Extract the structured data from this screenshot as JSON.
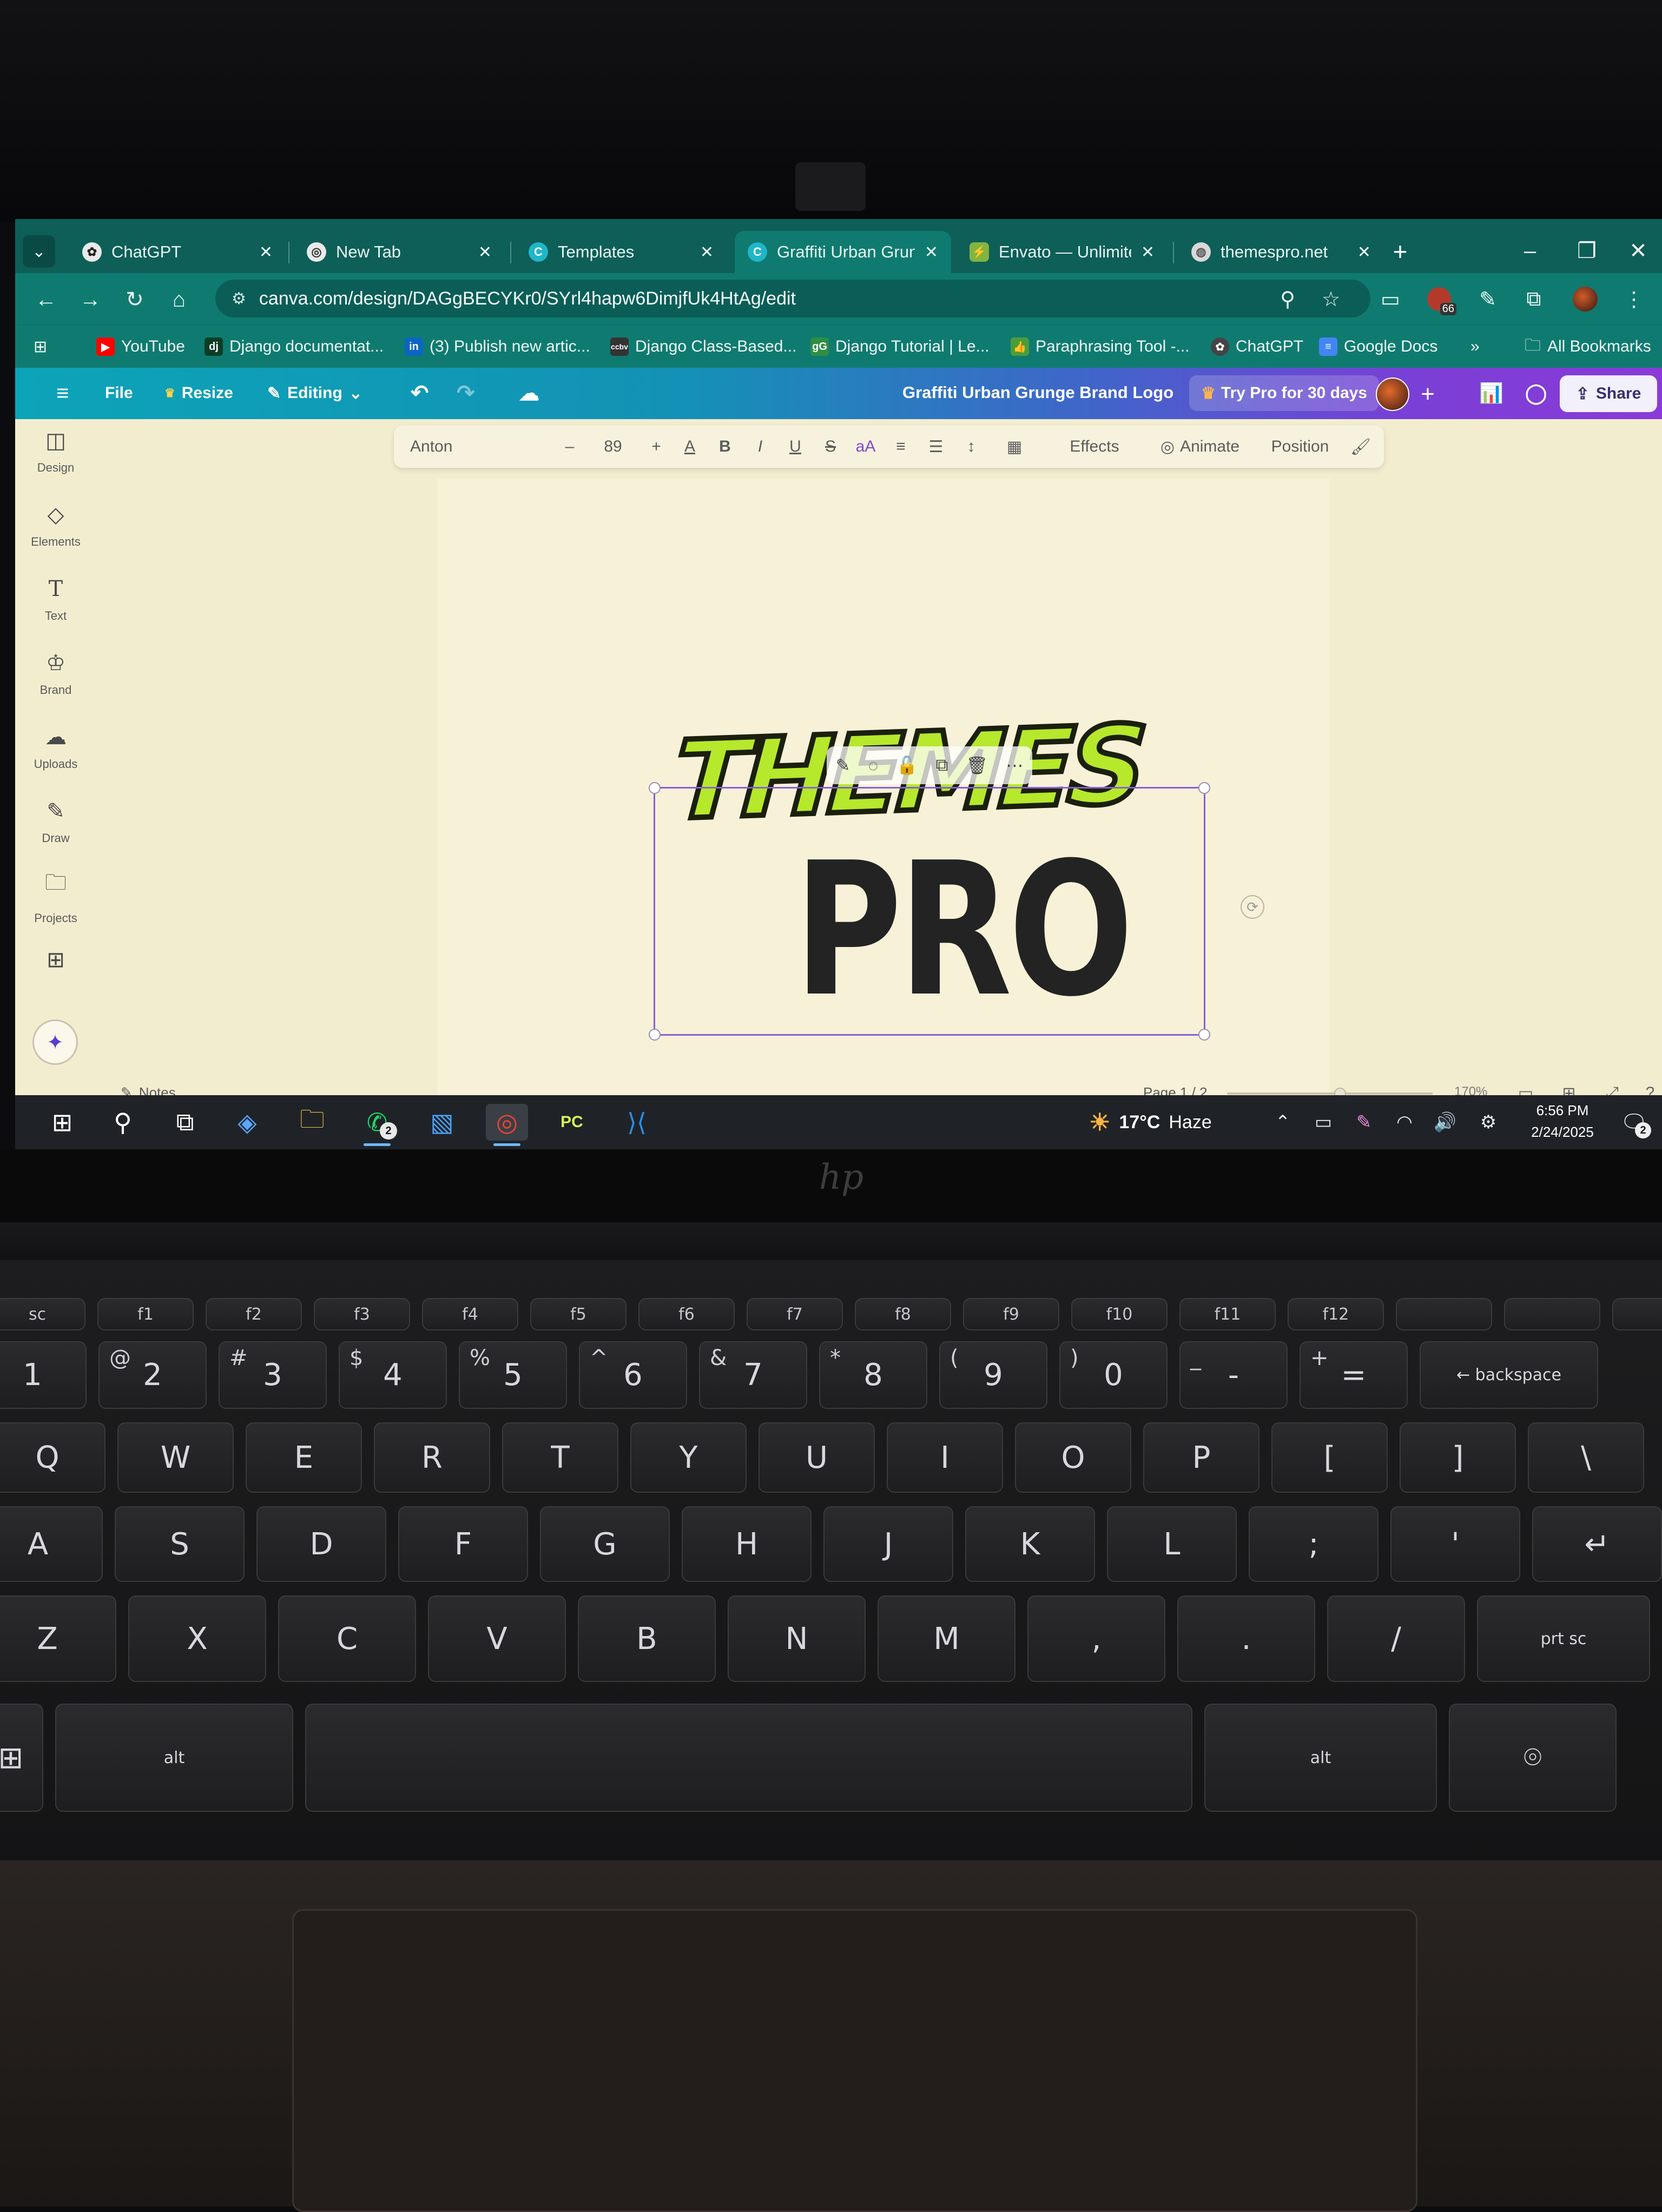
{
  "browser": {
    "tabs": [
      {
        "title": "ChatGPT",
        "favicon": "chatgpt-icon",
        "active": false
      },
      {
        "title": "New Tab",
        "favicon": "chrome-icon",
        "active": false
      },
      {
        "title": "Templates",
        "favicon": "canva-icon",
        "active": false
      },
      {
        "title": "Graffiti Urban Grun",
        "favicon": "canva-icon",
        "active": true
      },
      {
        "title": "Envato — Unlimite",
        "favicon": "envato-icon",
        "active": false
      },
      {
        "title": "themespro.net",
        "favicon": "globe-icon",
        "active": false
      }
    ],
    "url": "canva.com/design/DAGgBECYKr0/SYrl4hapw6DimjfUk4HtAg/edit",
    "extension_badge": "66",
    "bookmarks": [
      {
        "label": "YouTube",
        "icon": "youtube-icon",
        "color": "#ff0000"
      },
      {
        "label": "Django documentat...",
        "icon": "django-icon",
        "color": "#0c3c26"
      },
      {
        "label": "(3) Publish new artic...",
        "icon": "linkedin-icon",
        "color": "#0a66c2"
      },
      {
        "label": "Django Class-Based...",
        "icon": "ccbv-icon",
        "color": "#333333"
      },
      {
        "label": "Django Tutorial | Le...",
        "icon": "gfg-icon",
        "color": "#2f8d46"
      },
      {
        "label": "Paraphrasing Tool -...",
        "icon": "quillbot-icon",
        "color": "#4a9d3a"
      },
      {
        "label": "ChatGPT",
        "icon": "chatgpt-icon",
        "color": "#444444"
      },
      {
        "label": "Google Docs",
        "icon": "docs-icon",
        "color": "#4285f4"
      }
    ],
    "more_bookmarks": "»",
    "all_bookmarks": "All Bookmarks"
  },
  "canva": {
    "file": "File",
    "resize": "Resize",
    "editing": "Editing",
    "title": "Graffiti Urban Grunge Brand Logo",
    "try_pro": "Try Pro for 30 days",
    "share": "Share",
    "left_nav": [
      "Design",
      "Elements",
      "Text",
      "Brand",
      "Uploads",
      "Draw",
      "Projects"
    ],
    "text_toolbar": {
      "font": "Anton",
      "size": "89",
      "effects": "Effects",
      "animate": "Animate",
      "position": "Position"
    },
    "canvas": {
      "line1": "THEMES",
      "line2": "PRO"
    },
    "footer": {
      "notes": "Notes",
      "page": "Page 1 / 2",
      "zoom": "170%",
      "zoom_fraction": 0.55
    }
  },
  "taskbar": {
    "weather_temp": "17°C",
    "weather_desc": "Haze",
    "time": "6:56 PM",
    "date": "2/24/2025",
    "whatsapp_badge": "2",
    "notification_badge": "2"
  },
  "keyboard": {
    "fn_row": [
      "sc",
      "f1",
      "f2",
      "f3",
      "f4",
      "f5",
      "f6",
      "f7",
      "f8",
      "f9",
      "f10",
      "f11",
      "f12",
      "",
      "",
      ""
    ],
    "number_row": [
      {
        "main": "1",
        "top": "!"
      },
      {
        "main": "2",
        "top": "@"
      },
      {
        "main": "3",
        "top": "#"
      },
      {
        "main": "4",
        "top": "$"
      },
      {
        "main": "5",
        "top": "%"
      },
      {
        "main": "6",
        "top": "^"
      },
      {
        "main": "7",
        "top": "&"
      },
      {
        "main": "8",
        "top": "*"
      },
      {
        "main": "9",
        "top": "("
      },
      {
        "main": "0",
        "top": ")"
      },
      {
        "main": "-",
        "top": "_"
      },
      {
        "main": "=",
        "top": "+"
      },
      {
        "main": "← backspace",
        "top": ""
      }
    ],
    "qwerty_row": [
      "Q",
      "W",
      "E",
      "R",
      "T",
      "Y",
      "U",
      "I",
      "O",
      "P",
      "[",
      "]",
      "\\"
    ],
    "home_row": [
      "A",
      "S",
      "D",
      "F",
      "G",
      "H",
      "J",
      "K",
      "L",
      ";",
      "'",
      "↵"
    ],
    "bottom_row": [
      "Z",
      "X",
      "C",
      "V",
      "B",
      "N",
      "M",
      ",",
      ".",
      "/",
      "prt sc"
    ],
    "space_row": [
      "⊞",
      "alt",
      "",
      "alt",
      "⌾"
    ]
  }
}
